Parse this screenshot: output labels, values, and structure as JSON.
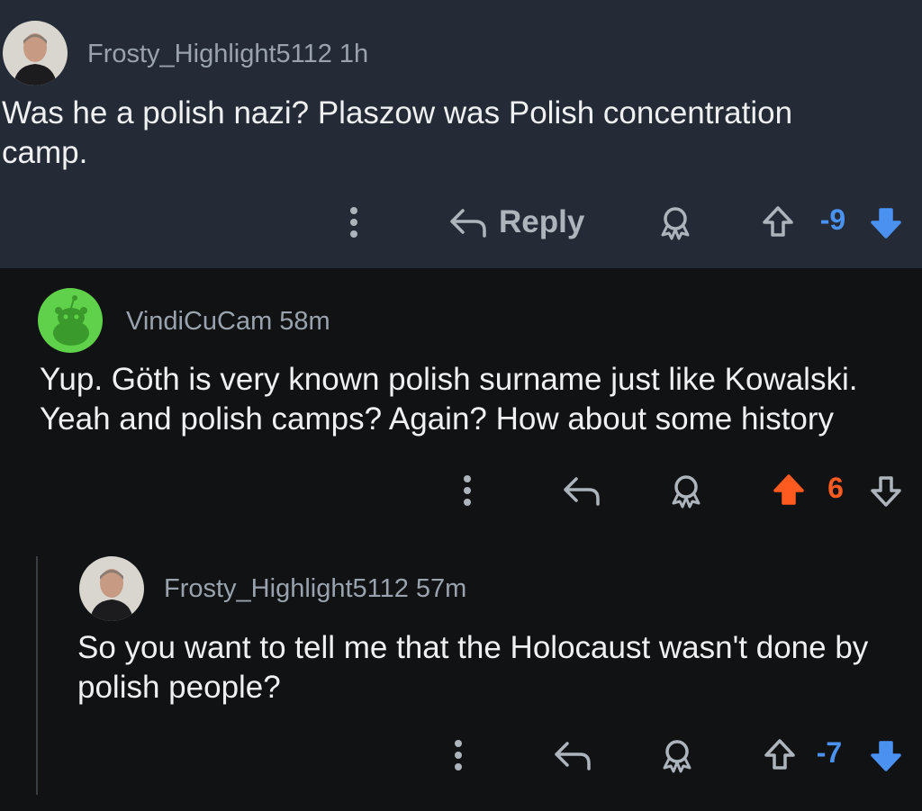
{
  "comments": [
    {
      "username": "Frosty_Highlight5112",
      "time": "1h",
      "text": "Was he a polish nazi? Plaszow was  Polish concentration camp.",
      "reply_label": "Reply",
      "score": "-9",
      "vote": "down",
      "score_color": "#4b92f0"
    },
    {
      "username": "VindiCuCam",
      "time": "58m",
      "text": "Yup. Göth is very known polish surname just like Kowalski. Yeah and polish camps? Again? How about some history",
      "score": "6",
      "vote": "up",
      "score_color": "#ff5a1f"
    },
    {
      "username": "Frosty_Highlight5112",
      "time": "57m",
      "text": "So you want to tell me that the Holocaust wasn't done by polish people?",
      "score": "-7",
      "vote": "down",
      "score_color": "#4b92f0"
    }
  ],
  "icons": {
    "more": "more-options-icon",
    "reply": "reply-arrow-icon",
    "award": "award-icon",
    "upvote": "upvote-arrow-icon",
    "downvote": "downvote-arrow-icon"
  }
}
